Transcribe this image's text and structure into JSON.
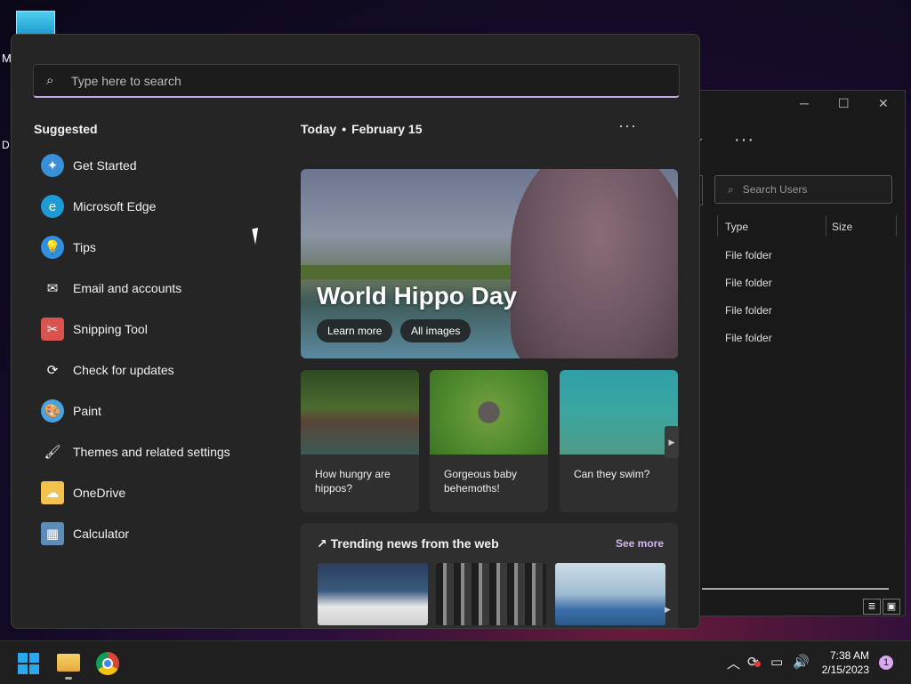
{
  "desktop": {
    "label_m": "M",
    "label_d": "D"
  },
  "explorer": {
    "search_placeholder": "Search Users",
    "columns": [
      "Type",
      "Size"
    ],
    "rows": [
      "File folder",
      "File folder",
      "File folder",
      "File folder"
    ]
  },
  "start_menu": {
    "search_placeholder": "Type here to search",
    "suggested_title": "Suggested",
    "suggested": [
      {
        "label": "Get Started",
        "icon": "get-started-icon",
        "color": "#3a8fd8"
      },
      {
        "label": "Microsoft Edge",
        "icon": "edge-icon",
        "color": "#1e9bd7"
      },
      {
        "label": "Tips",
        "icon": "lightbulb-icon",
        "color": "#2f8fe0"
      },
      {
        "label": "Email and accounts",
        "icon": "mail-icon",
        "color": "#252525"
      },
      {
        "label": "Snipping Tool",
        "icon": "scissors-icon",
        "color": "#d9534f"
      },
      {
        "label": "Check for updates",
        "icon": "refresh-icon",
        "color": "#252525"
      },
      {
        "label": "Paint",
        "icon": "palette-icon",
        "color": "#4aa3df"
      },
      {
        "label": "Themes and related settings",
        "icon": "brush-icon",
        "color": "#252525"
      },
      {
        "label": "OneDrive",
        "icon": "folder-icon",
        "color": "#f2c14e"
      },
      {
        "label": "Calculator",
        "icon": "calculator-icon",
        "color": "#5b8db8"
      }
    ],
    "today": {
      "label": "Today",
      "date": "February 15"
    },
    "hero": {
      "title": "World Hippo Day",
      "learn_more": "Learn more",
      "all_images": "All images"
    },
    "cards": [
      {
        "caption": "How hungry are hippos?"
      },
      {
        "caption": "Gorgeous baby behemoths!"
      },
      {
        "caption": "Can they swim?"
      }
    ],
    "trending": {
      "title": "Trending news from the web",
      "see_more": "See more"
    }
  },
  "taskbar": {
    "time": "7:38 AM",
    "date": "2/15/2023",
    "notifications": "1"
  },
  "colors": {
    "accent": "#c9a6e6",
    "link": "#d7b6f2",
    "panel": "#252525"
  }
}
